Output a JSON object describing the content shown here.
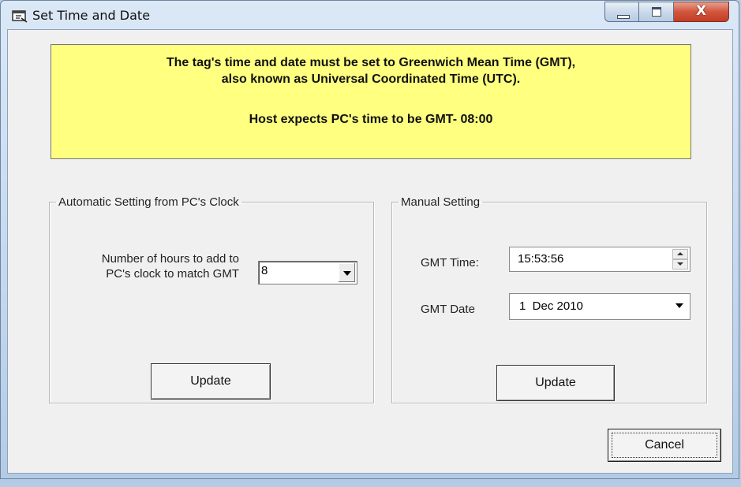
{
  "window": {
    "title": "Set Time and Date",
    "icon": "app-window-icon",
    "controls": {
      "minimize": "minimize-icon",
      "maximize": "maximize-icon",
      "close": "close-icon",
      "close_glyph": "X"
    }
  },
  "banner": {
    "line1": "The tag's time and date must be set to Greenwich Mean Time (GMT),",
    "line2": "also known as Universal Coordinated Time (UTC).",
    "line3": "Host expects PC's time to be GMT- 08:00",
    "background": "#ffff80"
  },
  "automatic": {
    "legend": "Automatic Setting from PC's Clock",
    "hours_label_line1": "Number of hours to add to",
    "hours_label_line2": "PC's clock to match GMT",
    "hours_value": "8",
    "update_label": "Update"
  },
  "manual": {
    "legend": "Manual Setting",
    "time_label": "GMT Time:",
    "time_value": "15:53:56",
    "date_label": "GMT Date",
    "date_value": "1  Dec 2010",
    "update_label": "Update"
  },
  "footer": {
    "cancel_label": "Cancel"
  }
}
